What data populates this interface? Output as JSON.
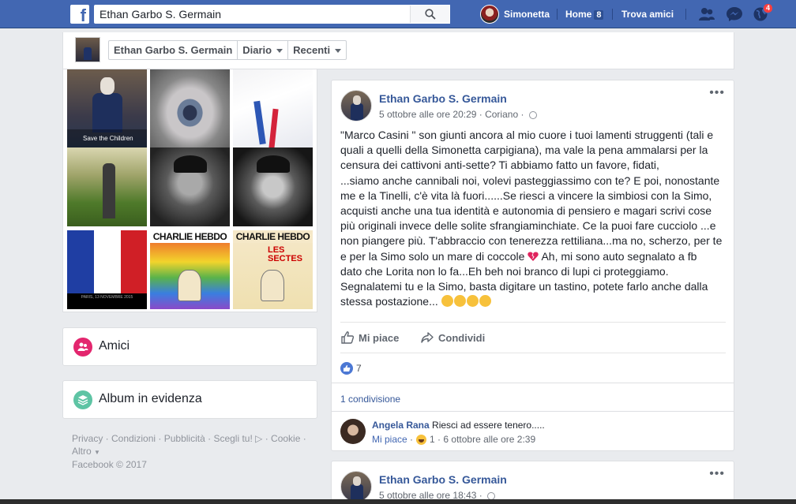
{
  "topbar": {
    "logo": "f",
    "search_value": "Ethan Garbo S. Germain",
    "user_name": "Simonetta",
    "home_label": "Home",
    "home_count": "8",
    "find_friends_label": "Trova amici",
    "notifications_count": "4",
    "icons": [
      "friend-requests-icon",
      "messenger-icon",
      "notifications-globe-icon"
    ]
  },
  "profile_header": {
    "name": "Ethan Garbo S. Germain",
    "diario_label": "Diario",
    "recenti_label": "Recenti"
  },
  "left": {
    "photo_captions": {
      "save_children": "Save the Children",
      "charlie1": "CHARLIE HEBDO",
      "charlie2": "CHARLIE HEBDO",
      "les_sectes": "LES SECTES",
      "paris_date": "PARIS, 13 NOVEMBRE 2015"
    },
    "friends_label": "Amici",
    "albums_label": "Album in evidenza",
    "footer": {
      "privacy": "Privacy",
      "conditions": "Condizioni",
      "ads": "Pubblicità",
      "adchoices": "Scegli tu!",
      "cookie": "Cookie",
      "more": "Altro",
      "copyright": "Facebook © 2017"
    }
  },
  "posts": [
    {
      "author": "Ethan Garbo S. Germain",
      "time": "5 ottobre alle ore 20:29",
      "location": "Coriano",
      "text_part1": "\"Marco Casini \" son giunti ancora al mio cuore i tuoi lamenti struggenti (tali e\nquali a quelli della Simonetta carpigiana), ma vale la pena ammalarsi per la\ncensura dei cattivoni anti-sette? Ti abbiamo fatto un favore, fidati,\n...siamo anche cannibali noi, volevi pasteggiassimo con te? E poi, nonostante\nme e la Tinelli, c'è vita là fuori......Se riesci a vincere la simbiosi con la Simo,\nacquisti anche una tua identità e autonomia di pensiero e magari scrivi cose\npiù originali invece delle solite sfrangiaminchiate. Ce la puoi fare cucciolo ...e\nnon piangere più. T'abbraccio con tenerezza rettiliana...ma no, scherzo, per te\ne per la Simo solo un mare di coccole ",
      "text_part2": " Ah, mi sono auto segnalato a fb\ndato che Lorita non lo fa...Eh beh noi branco di lupi ci proteggiamo.\nSegnalatemi tu e la Simo, basta digitare un tastino, potete farlo anche dalla\nstessa postazione... ",
      "like_label": "Mi piace",
      "share_label": "Condividi",
      "likes_count": "7",
      "shares_label": "1 condivisione",
      "comment": {
        "author": "Angela Rana",
        "text": "Riesci ad essere tenero.....",
        "like_label": "Mi piace",
        "reactions_count": "1",
        "time": "6 ottobre alle ore 2:39"
      }
    },
    {
      "author": "Ethan Garbo S. Germain",
      "time": "5 ottobre alle ore 18:43"
    }
  ]
}
